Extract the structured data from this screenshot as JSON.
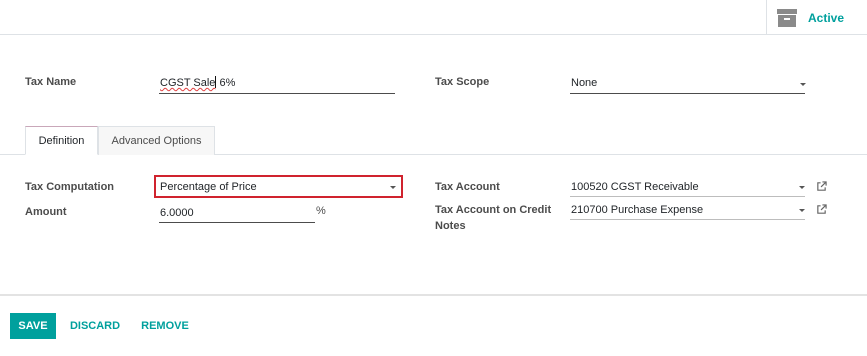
{
  "status": {
    "active_label": "Active",
    "icon": "archive-icon"
  },
  "form": {
    "tax_name": {
      "label": "Tax Name",
      "value_before_cursor": "CGST Sale",
      "value_after_cursor": " 6%"
    },
    "tax_scope": {
      "label": "Tax Scope",
      "value": "None"
    }
  },
  "tabs": [
    {
      "label": "Definition",
      "active": true
    },
    {
      "label": "Advanced Options",
      "active": false
    }
  ],
  "definition": {
    "tax_computation": {
      "label": "Tax Computation",
      "value": "Percentage of Price"
    },
    "amount": {
      "label": "Amount",
      "value": "6.0000",
      "unit": "%"
    },
    "tax_account": {
      "label": "Tax Account",
      "value": "100520 CGST Receivable"
    },
    "tax_account_credit": {
      "label_line1": "Tax Account on Credit",
      "label_line2": "Notes",
      "value": "210700 Purchase Expense"
    }
  },
  "buttons": {
    "save": "SAVE",
    "discard": "DISCARD",
    "remove": "REMOVE"
  },
  "colors": {
    "accent": "#00a09d",
    "highlight": "#d0232e"
  }
}
